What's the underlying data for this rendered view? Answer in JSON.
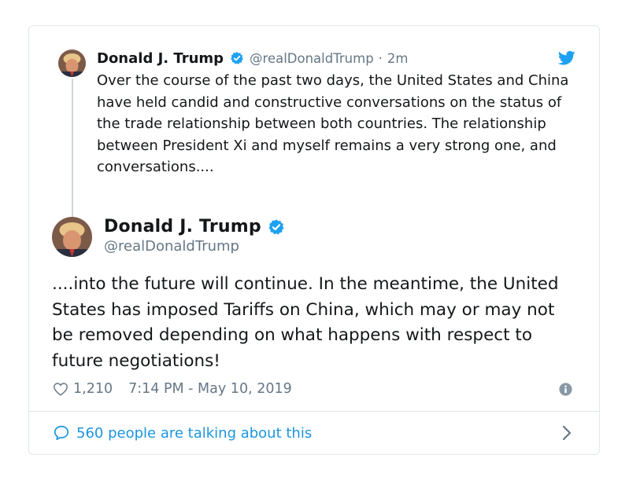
{
  "parent_tweet": {
    "author_name": "Donald J. Trump",
    "handle": "@realDonaldTrump",
    "separator": "·",
    "time_ago": "2m",
    "text": "Over the course of the past two days, the United States and China have held candid and constructive conversations on the status of the trade relationship between both countries. The relationship between President Xi and myself remains a very strong one, and conversations...."
  },
  "main_tweet": {
    "author_name": "Donald J. Trump",
    "handle": "@realDonaldTrump",
    "text": "....into the future will continue. In the meantime, the United States has imposed Tariffs on China, which may or may not be removed depending on what happens with respect to future negotiations!",
    "like_count": "1,210",
    "timestamp": "7:14 PM - May 10, 2019"
  },
  "footer": {
    "talking_label": "560 people are talking about this"
  },
  "icons": {
    "verified": "verified-badge-icon",
    "bird": "twitter-bird-icon",
    "like": "heart-outline-icon",
    "info": "info-icon",
    "reply": "speech-bubble-icon",
    "chevron": "chevron-right-icon"
  },
  "colors": {
    "brand_blue": "#1da1f2",
    "link_blue": "#1b95e0",
    "text": "#14171a",
    "muted": "#657786",
    "border": "#e1e8ed"
  }
}
